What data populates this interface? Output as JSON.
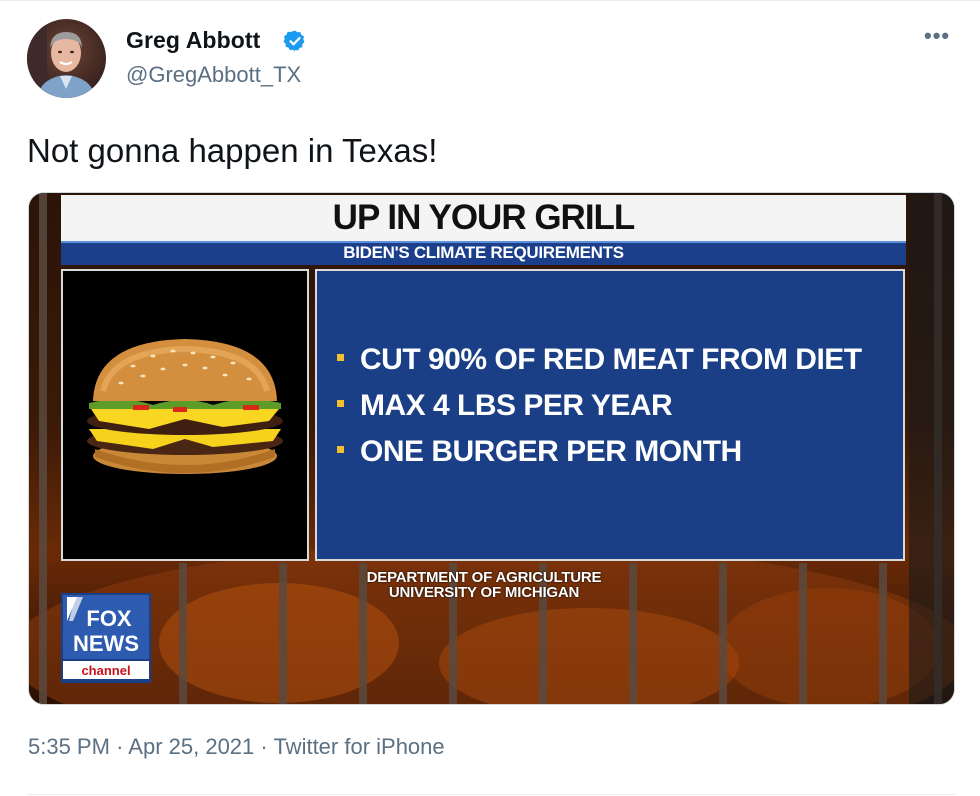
{
  "user": {
    "display_name": "Greg Abbott",
    "handle": "@GregAbbott_TX",
    "verified": true
  },
  "more_menu": "•••",
  "tweet": {
    "text": "Not gonna happen in Texas!"
  },
  "media": {
    "headline": "UP IN YOUR GRILL",
    "subheadline": "BIDEN'S CLIMATE REQUIREMENTS",
    "bullets": [
      "CUT 90% OF RED MEAT FROM DIET",
      "MAX 4 LBS PER YEAR",
      "ONE BURGER PER MONTH"
    ],
    "source_line_1": "DEPARTMENT OF AGRICULTURE",
    "source_line_2": "UNIVERSITY OF MICHIGAN",
    "logo": {
      "line1": "FOX",
      "line2": "NEWS",
      "line3": "channel"
    }
  },
  "meta": {
    "time": "5:35 PM",
    "date": "Apr 25, 2021",
    "client": "Twitter for iPhone",
    "separator": "·"
  },
  "colors": {
    "name": "#0f1419",
    "secondary": "#5b7083",
    "verified": "#1d9bf0",
    "fox_blue": "#1a3f86"
  }
}
